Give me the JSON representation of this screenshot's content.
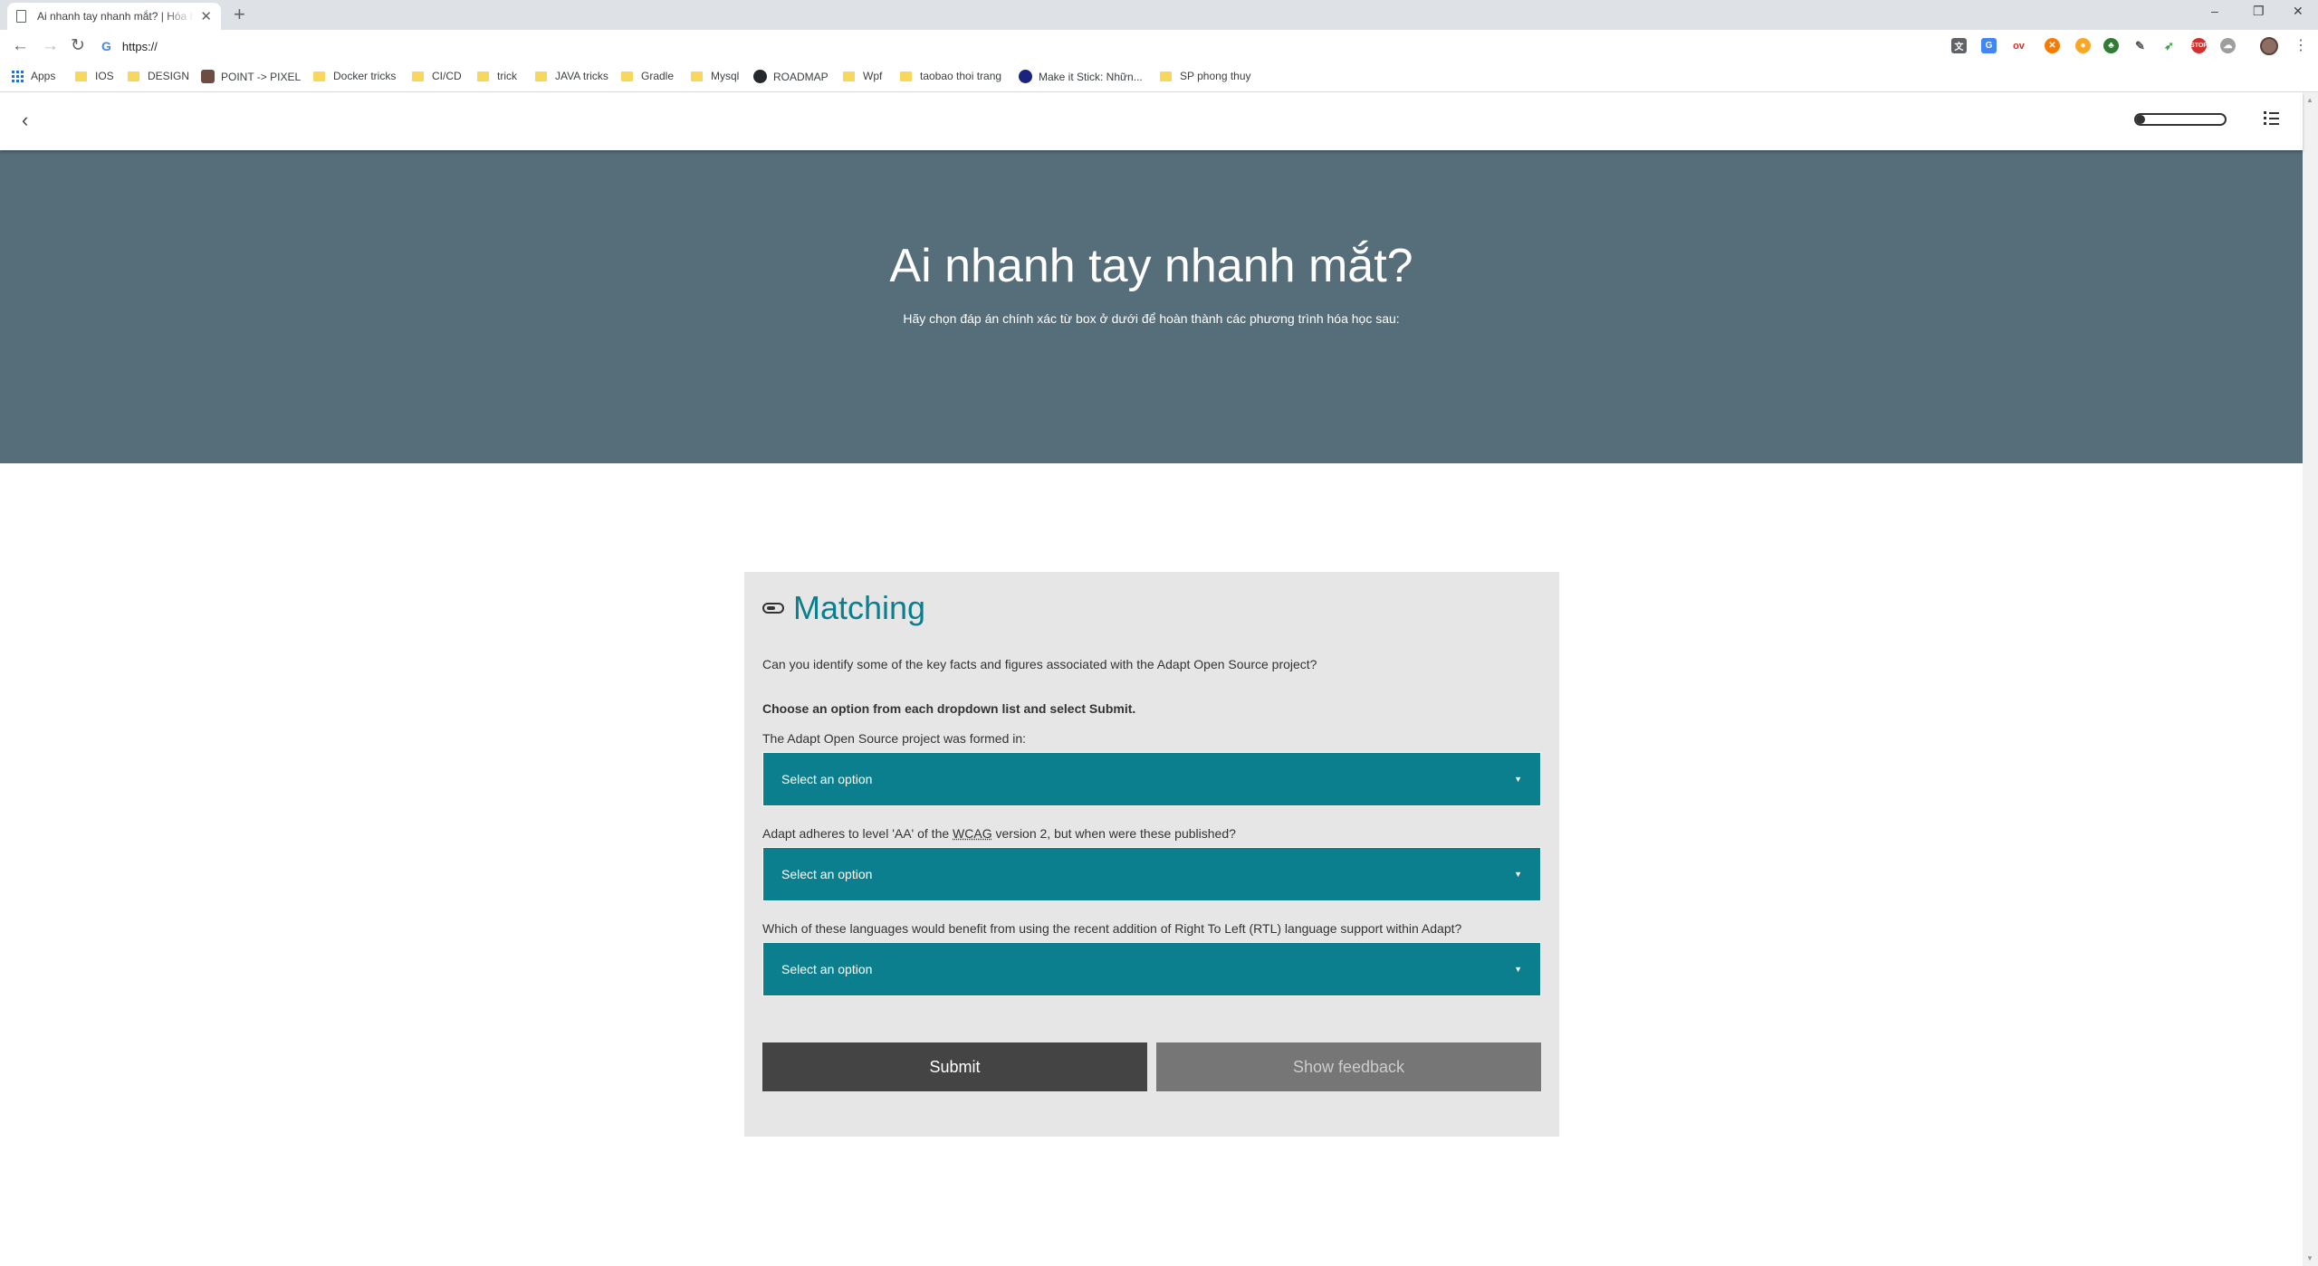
{
  "browser": {
    "tab_title": "Ai nhanh tay nhanh mắt? | Hóa h",
    "url": "https://",
    "bookmarks": [
      {
        "label": "Apps",
        "type": "apps"
      },
      {
        "label": "IOS",
        "type": "folder"
      },
      {
        "label": "DESIGN",
        "type": "folder"
      },
      {
        "label": "POINT -> PIXEL",
        "type": "site"
      },
      {
        "label": "Docker tricks",
        "type": "folder"
      },
      {
        "label": "CI/CD",
        "type": "folder"
      },
      {
        "label": "trick",
        "type": "folder"
      },
      {
        "label": "JAVA tricks",
        "type": "folder"
      },
      {
        "label": "Gradle",
        "type": "folder"
      },
      {
        "label": "Mysql",
        "type": "folder"
      },
      {
        "label": "ROADMAP",
        "type": "github"
      },
      {
        "label": "Wpf",
        "type": "folder"
      },
      {
        "label": "taobao thoi trang",
        "type": "folder"
      },
      {
        "label": "Make it Stick: Nhữn...",
        "type": "site"
      },
      {
        "label": "SP phong thuy",
        "type": "folder"
      }
    ]
  },
  "page": {
    "progress_fraction": 0.1,
    "hero": {
      "title": "Ai nhanh tay nhanh mắt?",
      "subtitle": "Hãy chọn đáp án chính xác từ box ở dưới để hoàn thành các phương trình hóa học sau:"
    },
    "question": {
      "title": "Matching",
      "body": "Can you identify some of the key facts and figures associated with the Adapt Open Source project?",
      "instruction": "Choose an option from each dropdown list and select Submit.",
      "items": [
        {
          "prompt": "The Adapt Open Source project was formed in:",
          "select_value": "Select an option"
        },
        {
          "prompt_before": "Adapt adheres to level 'AA' of the ",
          "prompt_abbr": "WCAG",
          "prompt_after": " version 2, but when were these published?",
          "select_value": "Select an option"
        },
        {
          "prompt": "Which of these languages would benefit from using the recent addition of Right To Left (RTL) language support within Adapt?",
          "select_value": "Select an option"
        }
      ],
      "submit_label": "Submit",
      "feedback_label": "Show feedback"
    }
  },
  "colors": {
    "hero_bg": "#566e7a",
    "accent": "#0b7f8e",
    "submit_bg": "#444444",
    "feedback_bg": "#767676"
  }
}
